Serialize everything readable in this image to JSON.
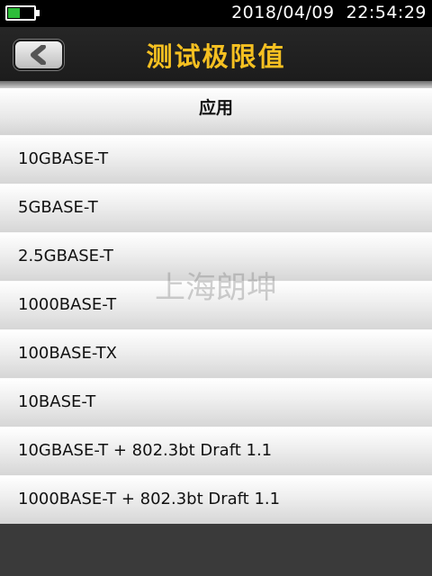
{
  "status_bar": {
    "battery_level": 0.45,
    "datetime": "2018/04/09  22:54:29"
  },
  "header": {
    "title": "测试极限值",
    "back_icon": "chevron-left-icon"
  },
  "section": {
    "label": "应用"
  },
  "items": [
    {
      "label": "10GBASE-T"
    },
    {
      "label": "5GBASE-T"
    },
    {
      "label": "2.5GBASE-T"
    },
    {
      "label": "1000BASE-T"
    },
    {
      "label": "100BASE-TX"
    },
    {
      "label": "10BASE-T"
    },
    {
      "label": "10GBASE-T + 802.3bt Draft 1.1"
    },
    {
      "label": "1000BASE-T + 802.3bt Draft 1.1"
    }
  ],
  "watermark": "上海朗坤",
  "colors": {
    "title": "#f5c021",
    "battery": "#2ebd3a",
    "bar_bg": "#1c1c1c"
  }
}
